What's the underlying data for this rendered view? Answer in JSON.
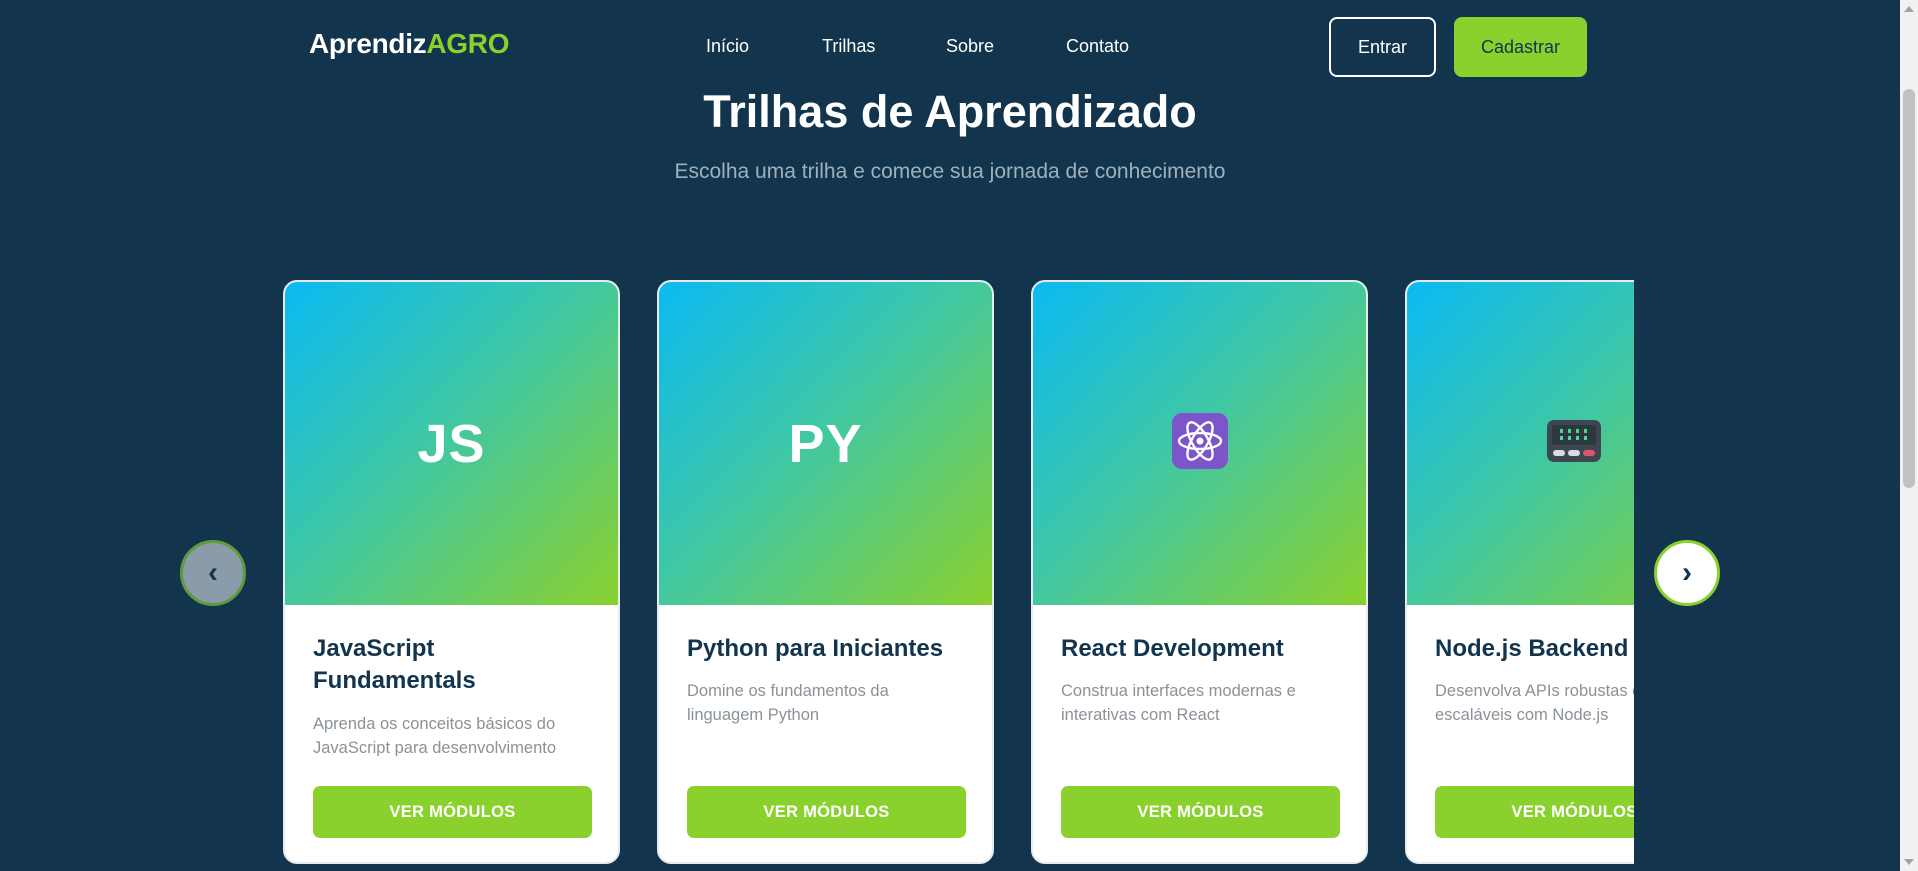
{
  "header": {
    "logo_main": "Aprendiz",
    "logo_accent": "AGRO",
    "nav": [
      "Início",
      "Trilhas",
      "Sobre",
      "Contato"
    ],
    "login_label": "Entrar",
    "signup_label": "Cadastrar"
  },
  "hero": {
    "title": "Trilhas de Aprendizado",
    "subtitle": "Escolha uma trilha e comece sua jornada de conhecimento"
  },
  "carousel": {
    "prev_label": "‹",
    "next_label": "›",
    "cards": [
      {
        "icon": "JS",
        "title": "JavaScript Fundamentals",
        "description": "Aprenda os conceitos básicos do JavaScript para desenvolvimento web",
        "button": "VER MÓDULOS"
      },
      {
        "icon": "PY",
        "title": "Python para Iniciantes",
        "description": "Domine os fundamentos da linguagem Python",
        "button": "VER MÓDULOS"
      },
      {
        "icon": "atom-icon",
        "title": "React Development",
        "description": "Construa interfaces modernas e interativas com React",
        "button": "VER MÓDULOS"
      },
      {
        "icon": "pager-icon",
        "title": "Node.js Backend",
        "description": "Desenvolva APIs robustas e escaláveis com Node.js",
        "button": "VER MÓDULOS"
      }
    ]
  },
  "colors": {
    "background": "#12354d",
    "accent": "#8bd12e",
    "gradient_start": "#0abaf2"
  }
}
